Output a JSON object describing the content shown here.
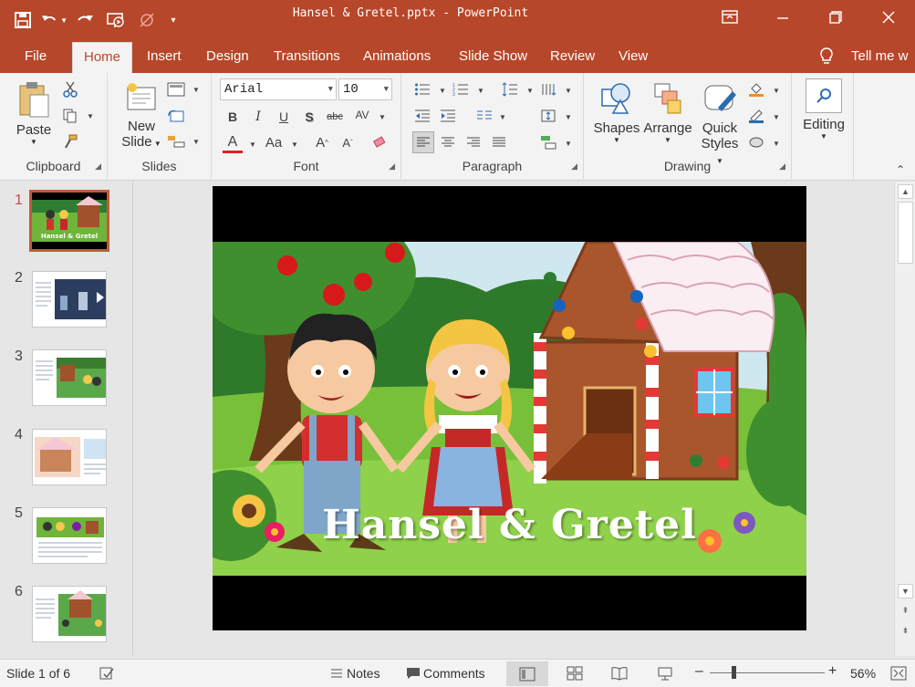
{
  "window": {
    "title": "Hansel & Gretel.pptx - PowerPoint"
  },
  "tabs": [
    "File",
    "Home",
    "Insert",
    "Design",
    "Transitions",
    "Animations",
    "Slide Show",
    "Review",
    "View"
  ],
  "tell_me": "Tell me w",
  "ribbon": {
    "clipboard": {
      "label": "Clipboard",
      "paste": "Paste"
    },
    "slides": {
      "label": "Slides",
      "new_slide_1": "New",
      "new_slide_2": "Slide"
    },
    "font": {
      "label": "Font",
      "font_name": "Arial",
      "font_size": "10"
    },
    "paragraph": {
      "label": "Paragraph"
    },
    "drawing": {
      "label": "Drawing",
      "shapes": "Shapes",
      "arrange": "Arrange",
      "quick_styles_1": "Quick",
      "quick_styles_2": "Styles"
    },
    "editing": {
      "label": "Editing"
    }
  },
  "thumbnails": [
    {
      "num": "1"
    },
    {
      "num": "2"
    },
    {
      "num": "3"
    },
    {
      "num": "4"
    },
    {
      "num": "5"
    },
    {
      "num": "6"
    }
  ],
  "slide": {
    "title": "Hansel & Gretel"
  },
  "status": {
    "slide_of": "Slide 1 of 6",
    "notes": "Notes",
    "comments": "Comments",
    "zoom": "56%"
  },
  "colors": {
    "brand": "#b7472a",
    "ribbon_bg": "#f3f3f3",
    "active_thumb": "#c55a3a"
  }
}
